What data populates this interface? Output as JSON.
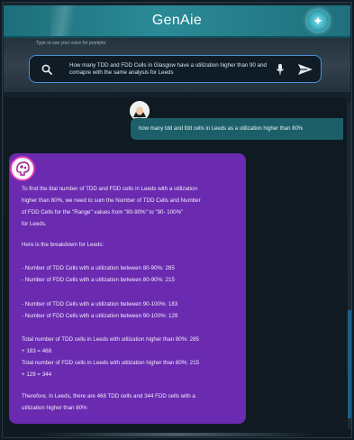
{
  "app": {
    "title": "GenAie"
  },
  "prompt": {
    "label": "Type or use your voice for prompts",
    "line1": "How many TDD and FDD Cells in Glasgow have a utilization higher than 90 and",
    "line2": "comapre with the same analysis for Leeds"
  },
  "user_message": "how many tdd and fdd cells in Leeds as a utilization higher than 80%",
  "bot_lines": [
    "To find the tital number of TDD and FDD cells in Leeds with a utilization",
    "higher than 80%, we need to sum the Number of TDD Cells and Number",
    "of FDD Cells for the \"Range\" values from \"80-90%\" to \"90- 100%\"",
    "for Leeds.",
    "Here is the breakdown for Leeds:",
    "- Number of TDD Cells with a utilization between 80-90%: 285",
    "- Number of FDD Cells with a utilization between 80-90%: 215",
    "- Number of TDD Cells with a utilization between 90-100%: 183",
    "- Number of FDD Cells with a utilization between 90-100%: 129",
    "Total number of TDD cells in Leeds with utilization higher than 80%: 285",
    "+ 183 = 468",
    "Total number of FDD cells in Leeds with utilization higher than 80%: 215",
    "+ 129 = 344",
    "Therefore, in Leeds, there are 468 TDD cells and 344 FDD cells with a",
    "utilization higher than 80%"
  ],
  "colors": {
    "header": "#2a8b96",
    "bot_bubble": "#6a2bb0",
    "user_bubble": "#1c5f69",
    "prompt_border": "#4a8fd8"
  },
  "icons": [
    "sparkle-icon",
    "search-icon",
    "microphone-icon",
    "send-icon",
    "user-avatar",
    "bot-avatar"
  ]
}
